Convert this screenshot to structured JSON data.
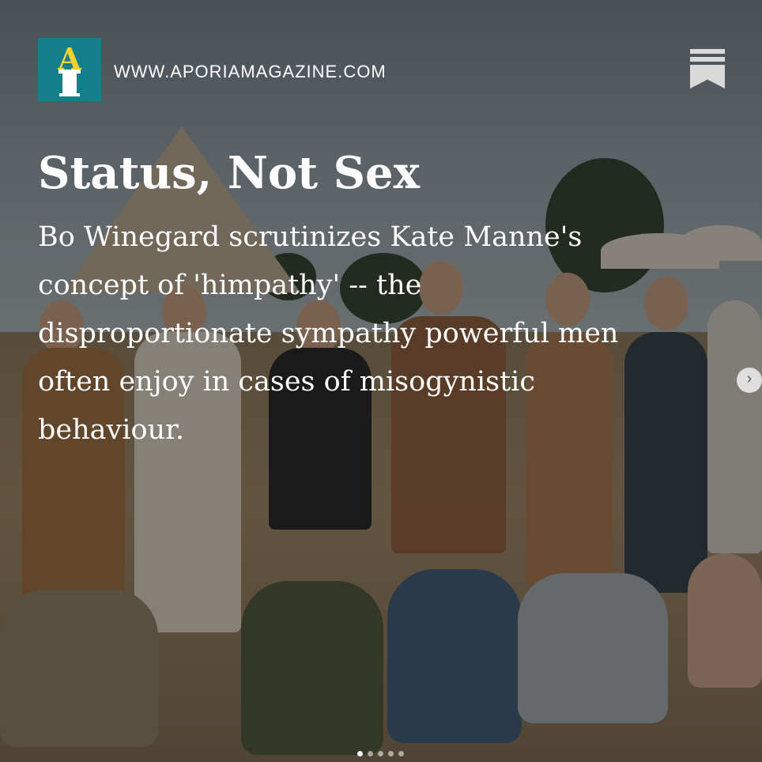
{
  "header": {
    "logo_letter": "A",
    "site_url": "WWW.APORIAMAGAZINE.COM",
    "bookmark_icon": "bookmark-icon"
  },
  "article": {
    "title": "Status, Not Sex",
    "subtitle": "Bo Winegard scrutinizes Kate Manne's concept of 'himpathy' -- the disproportionate sympathy powerful men often enjoy in cases of misogynistic behaviour."
  },
  "carousel": {
    "next_icon": "chevron-right-icon",
    "next_glyph": "›",
    "slide_count": 5,
    "active_index": 0
  },
  "colors": {
    "logo_bg": "#137f8b",
    "logo_letter": "#f2d22e",
    "text": "#ffffff"
  }
}
